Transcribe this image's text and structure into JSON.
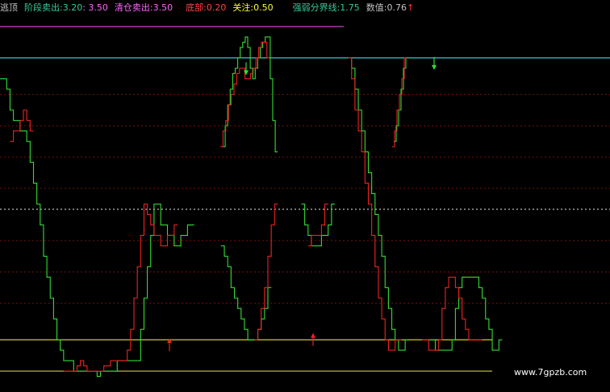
{
  "header": {
    "indicator_name": "逃顶",
    "stage_sell_label": "阶段卖出:",
    "stage_sell_value_a": "3.20",
    "stage_sell_value_b": ": 3.50",
    "clear_sell_label": "清仓卖出:",
    "clear_sell_value": "3.50",
    "bottom_label": "底部:",
    "bottom_value": "0.20",
    "watch_label": "关注:",
    "watch_value": "0.50",
    "strength_label": "强弱分界线:",
    "strength_value": "1.75",
    "value_label": "数值:",
    "value_value": "0.76",
    "arrow": "↑",
    "colors": {
      "name": "#c0c0c0",
      "stage": "#33cc99",
      "clear": "#ff66ff",
      "bottom": "#ff4444",
      "watch": "#ffff33",
      "strength": "#33cc99",
      "value": "#c0c0c0",
      "arrow": "#ff3333"
    }
  },
  "watermark": "www.7gpzb.com",
  "chart_data": {
    "type": "line",
    "ylim": [
      0,
      3.6
    ],
    "grid": true,
    "reference_lines": [
      {
        "value": 3.5,
        "color": "#cc44cc",
        "style": "solid"
      },
      {
        "value": 3.2,
        "color": "#33cccc",
        "style": "solid"
      },
      {
        "value": 1.75,
        "color": "#bbbbbb",
        "style": "dotted"
      },
      {
        "value": 0.5,
        "color": "#cccc33",
        "style": "solid"
      },
      {
        "value": 0.2,
        "color": "#cccc33",
        "style": "solid"
      }
    ],
    "dotted_grid": [
      2.85,
      2.55,
      2.25,
      1.95,
      1.45,
      1.15,
      0.85
    ],
    "series": [
      {
        "color": "#33dd33",
        "values": [
          3.0,
          3.0,
          2.9,
          2.7,
          2.6,
          2.6,
          2.5,
          2.5,
          2.4,
          2.2,
          2.0,
          1.8,
          1.6,
          1.3,
          1.1,
          0.9,
          0.7,
          0.5,
          0.4,
          0.3,
          0.3,
          0.3,
          0.2,
          0.2,
          0.2,
          0.2,
          0.2,
          0.2,
          0.2,
          0.15,
          0.2,
          0.2,
          0.2,
          0.2,
          0.2,
          0.3,
          0.3,
          0.3,
          0.3,
          0.3,
          0.3,
          0.3,
          0.6,
          0.9,
          1.2,
          1.5,
          1.8,
          1.8,
          1.6,
          1.6,
          1.5,
          1.5,
          1.4,
          1.4,
          1.5,
          1.5,
          1.6,
          1.6,
          null,
          null,
          null,
          null,
          null,
          null,
          null,
          null,
          1.4,
          1.3,
          1.2,
          1.0,
          0.9,
          0.8,
          0.7,
          0.6,
          0.5,
          0.5,
          0.5,
          0.6,
          0.7,
          0.8,
          1.0,
          null,
          null,
          null,
          null,
          null,
          null,
          null,
          null,
          null,
          1.8,
          1.6,
          1.5,
          1.4,
          1.4,
          1.4,
          1.5,
          1.5,
          1.6,
          1.8,
          null,
          null,
          null,
          null,
          3.2,
          3.1,
          2.9,
          2.7,
          2.5,
          2.3,
          2.1,
          1.9,
          1.7,
          1.5,
          1.3,
          1.0,
          0.8,
          0.6,
          0.5,
          0.4,
          0.4,
          0.5,
          null,
          null,
          null,
          null,
          null,
          null,
          0.5,
          0.5,
          0.4,
          0.4,
          0.4,
          0.4,
          0.4,
          0.5,
          0.8,
          1.0,
          1.1,
          1.1,
          1.1,
          1.1,
          1.1,
          1.0,
          0.9,
          0.7,
          0.6,
          0.4,
          0.4,
          0.5
        ],
        "note": "indices with null are gaps"
      },
      {
        "color": "#ee2222",
        "values": [
          null,
          null,
          null,
          2.4,
          2.5,
          2.5,
          2.6,
          2.7,
          2.6,
          2.5,
          null,
          null,
          null,
          null,
          null,
          null,
          null,
          null,
          null,
          0.2,
          0.2,
          0.2,
          0.2,
          0.25,
          0.3,
          0.25,
          0.2,
          0.2,
          0.2,
          0.2,
          0.2,
          0.25,
          0.25,
          0.3,
          0.3,
          0.3,
          0.3,
          0.3,
          0.4,
          0.6,
          0.9,
          1.2,
          1.5,
          1.8,
          1.7,
          1.6,
          1.5,
          1.5,
          1.4,
          1.4,
          1.5,
          1.5,
          1.6,
          null,
          null,
          null,
          null,
          null,
          null,
          null,
          null,
          null,
          null,
          null,
          null,
          null,
          null,
          null,
          null,
          null,
          null,
          null,
          null,
          null,
          null,
          null,
          0.5,
          0.6,
          0.8,
          1.0,
          1.3,
          1.6,
          1.8,
          null,
          null,
          null,
          null,
          null,
          null,
          null,
          null,
          null,
          1.4,
          1.5,
          1.5,
          1.5,
          1.6,
          1.8,
          null,
          null,
          null,
          null,
          null,
          null,
          3.2,
          3.0,
          2.7,
          2.5,
          2.3,
          2.0,
          1.8,
          1.5,
          1.2,
          0.9,
          0.7,
          0.5,
          0.4,
          0.4,
          0.5,
          0.5,
          null,
          null,
          null,
          null,
          null,
          null,
          0.5,
          0.5,
          0.4,
          0.4,
          0.4,
          0.5,
          0.8,
          1.0,
          1.1,
          1.1,
          1.0,
          0.9,
          0.7,
          0.6,
          0.5,
          0.5,
          0.5,
          0.5
        ]
      }
    ],
    "upper_segment": {
      "green": [
        2.35,
        2.55,
        2.75,
        2.9,
        3.05,
        3.1,
        3.2,
        3.3,
        3.35,
        3.4,
        3.3,
        3.1,
        3.0,
        3.1,
        3.2,
        3.3,
        3.35,
        3.4,
        3.4,
        3.0,
        2.6,
        2.3
      ],
      "red": [
        2.35,
        2.5,
        2.6,
        2.75,
        2.85,
        2.95,
        3.05,
        3.1,
        3.1,
        3.0,
        3.0,
        3.05,
        3.1,
        3.2,
        3.3,
        3.35,
        3.35,
        3.2
      ],
      "right_green": [
        2.4,
        2.55,
        2.7,
        2.9,
        3.1,
        3.2
      ],
      "right_red": [
        2.35,
        2.5,
        2.7,
        2.85,
        3.0,
        3.2
      ]
    },
    "arrows": [
      {
        "type": "down",
        "color": "#33dd33",
        "x_index": 0,
        "value": 3.05
      },
      {
        "type": "down",
        "color": "#33dd33",
        "x_index": 1,
        "value": 3.1
      },
      {
        "type": "up",
        "color": "#ee2222",
        "x_index": 2,
        "value": 0.5
      },
      {
        "type": "up",
        "color": "#ee2222",
        "x_index": 3,
        "value": 0.55
      }
    ]
  }
}
